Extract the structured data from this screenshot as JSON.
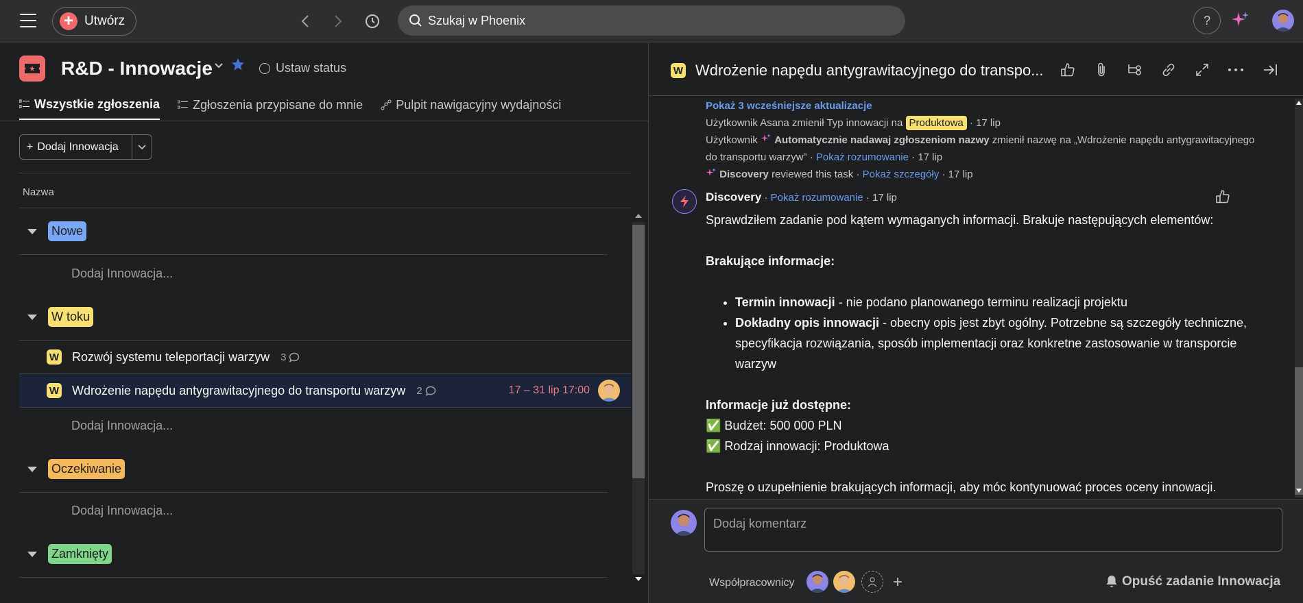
{
  "topbar": {
    "create_label": "Utwórz",
    "search_placeholder": "Szukaj w Phoenix",
    "help_label": "?"
  },
  "project": {
    "title": "R&D - Innowacje",
    "status_label": "Ustaw status",
    "tabs": [
      {
        "label": "Wszystkie zgłoszenia",
        "active": true
      },
      {
        "label": "Zgłoszenia przypisane do mnie",
        "active": false
      },
      {
        "label": "Pulpit nawigacyjny wydajności",
        "active": false
      }
    ],
    "add_button_label": "Dodaj Innowacja",
    "column_header": "Nazwa",
    "add_task_label": "Dodaj Innowacja...",
    "sections": [
      {
        "name": "Nowe",
        "color": "#7aa7f5"
      },
      {
        "name": "W toku",
        "color": "#f8df72"
      },
      {
        "name": "Oczekiwanie",
        "color": "#f6b85c"
      },
      {
        "name": "Zamknięty",
        "color": "#7fd68a"
      }
    ],
    "tasks": [
      {
        "icon": "W",
        "name": "Rozwój systemu teleportacji warzyw",
        "comments": "3",
        "date": "",
        "selected": false
      },
      {
        "icon": "W",
        "name": "Wdrożenie napędu antygrawitacyjnego do transportu warzyw",
        "comments": "2",
        "date": "17 – 31 lip 17:00",
        "selected": true
      }
    ]
  },
  "detail": {
    "title": "Wdrożenie napędu antygrawitacyjnego do transpo...",
    "icon": "W",
    "show_earlier": "Pokaż 3 wcześniejsze aktualizacje",
    "act1_prefix": "Użytkownik Asana zmienił Typ innowacji na",
    "act1_tag": "Produktowa",
    "act1_date": "· 17 lip",
    "act2_prefix": "Użytkownik",
    "act2_bold": "Automatycznie nadawaj zgłoszeniom nazwy",
    "act2_text": "zmienił nazwę na „Wdrożenie napędu antygrawitacyjnego do transportu warzyw”",
    "act2_link": "Pokaż rozumowanie",
    "act2_date": "· 17 lip",
    "act3_bold": "Discovery",
    "act3_text": "reviewed this task ·",
    "act3_link": "Pokaż szczegóły",
    "act3_date": "· 17 lip",
    "comment": {
      "author": "Discovery",
      "link": "Pokaż rozumowanie",
      "date": "· 17 lip",
      "intro": "Sprawdziłem zadanie pod kątem wymaganych informacji. Brakuje następujących elementów:",
      "missing_header": "Brakujące informacje:",
      "missing": [
        {
          "bold": "Termin innowacji",
          "text": " - nie podano planowanego terminu realizacji projektu"
        },
        {
          "bold": "Dokładny opis innowacji",
          "text": " - obecny opis jest zbyt ogólny. Potrzebne są szczegóły techniczne, specyfikacja rozwiązania, sposób implementacji oraz konkretne zastosowanie w transporcie warzyw"
        }
      ],
      "available_header": "Informacje już dostępne:",
      "available": [
        "✅ Budżet: 500 000 PLN",
        "✅ Rodzaj innowacji: Produktowa"
      ],
      "closing": "Proszę o uzupełnienie brakujących informacji, aby móc kontynuować proces oceny innowacji."
    },
    "comment_placeholder": "Dodaj komentarz",
    "collaborators_label": "Współpracownicy",
    "leave_label": "Opuść zadanie Innowacja"
  }
}
